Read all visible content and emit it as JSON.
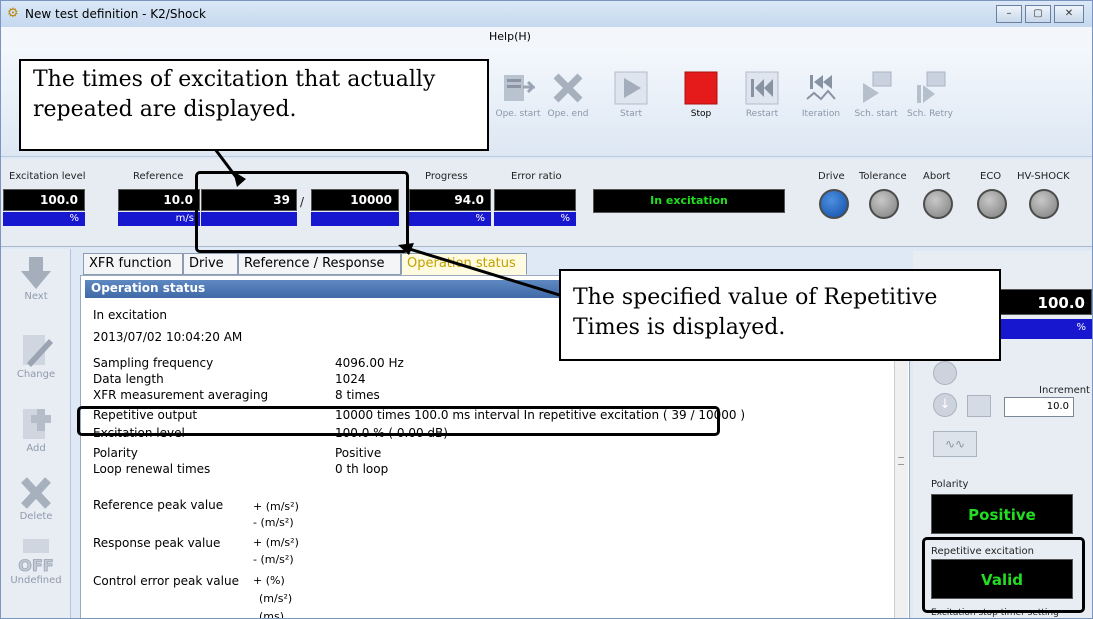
{
  "window": {
    "title": "New test definition - K2/Shock",
    "icon": "app-gear-icon",
    "min": "–",
    "max": "▢",
    "close": "✕"
  },
  "menu": {
    "help": "Help(H)"
  },
  "toolbar": {
    "buttons": [
      {
        "label": "Ope. start",
        "icon": "ope-start-icon"
      },
      {
        "label": "Ope. end",
        "icon": "ope-end-icon"
      },
      {
        "label": "Start",
        "icon": "play-icon"
      },
      {
        "label": "Stop",
        "icon": "stop-icon"
      },
      {
        "label": "Restart",
        "icon": "restart-icon"
      },
      {
        "label": "Iteration",
        "icon": "iteration-icon"
      },
      {
        "label": "Sch. start",
        "icon": "schedule-start-icon"
      },
      {
        "label": "Sch. Retry",
        "icon": "schedule-retry-icon"
      }
    ],
    "accent_stop": "#e51b1b"
  },
  "status": {
    "labels": {
      "excitation_level": "Excitation level",
      "reference": "Reference",
      "progress": "Progress",
      "error_ratio": "Error ratio",
      "drive": "Drive",
      "tolerance": "Tolerance",
      "abort": "Abort",
      "eco": "ECO",
      "hv_shock": "HV-SHOCK"
    },
    "values": {
      "excitation_level": "100.0",
      "reference": "10.0",
      "repeat_current": "39",
      "slash": "/",
      "repeat_total": "10000",
      "progress": "94.0",
      "error_ratio": ""
    },
    "units": {
      "excitation_level": "%",
      "reference": "m/s",
      "progress": "%",
      "error_ratio": "%"
    },
    "state": "In excitation",
    "drive_color": "#0f4fa8"
  },
  "sidebar": [
    {
      "label": "Next",
      "icon": "arrow-down-icon"
    },
    {
      "label": "Change",
      "icon": "pencil-icon"
    },
    {
      "label": "Add",
      "icon": "plus-icon"
    },
    {
      "label": "Delete",
      "icon": "x-icon"
    },
    {
      "label": "Undefined",
      "icon": "off-icon",
      "badge": "OFF"
    }
  ],
  "tabs": [
    "XFR function",
    "Drive",
    "Reference / Response",
    "Operation status"
  ],
  "panel": {
    "header": "Operation status",
    "state": "In excitation",
    "timestamp": "2013/07/02 10:04:20 AM",
    "rows": [
      {
        "k": "Sampling frequency",
        "v": "4096.00 Hz"
      },
      {
        "k": "Data length",
        "v": "1024"
      },
      {
        "k": "XFR measurement averaging",
        "v": "8 times"
      },
      {
        "k": "Repetitive output",
        "v": "10000 times 100.0 ms interval In repetitive excitation ( 39 / 10000 )"
      },
      {
        "k": "Excitation level",
        "v": "100.0 % ( 0.00 dB)"
      },
      {
        "k": "Polarity",
        "v": "Positive"
      },
      {
        "k": "Loop renewal times",
        "v": "0 th loop"
      }
    ],
    "peaks": [
      {
        "k": "Reference peak value",
        "u1": "+ (m/s²)",
        "u2": "- (m/s²)"
      },
      {
        "k": "Response peak value",
        "u1": "+ (m/s²)",
        "u2": "- (m/s²)"
      },
      {
        "k": "Control error peak value",
        "u1": "+ (%)",
        "u2": "(m/s²)",
        "u3": "(ms)"
      }
    ]
  },
  "right": {
    "level": "100.0",
    "unit": "%",
    "increment_label": "Increment",
    "increment_value": "10.0",
    "polarity_label": "Polarity",
    "polarity_value": "Positive",
    "rep_label": "Repetitive excitation",
    "rep_value": "Valid",
    "timer_label": "Excitation stop timer setting",
    "green": "#22dd22"
  },
  "callouts": {
    "c1": "The times of excitation that actually repeated are displayed.",
    "c2": "The specified value of Repetitive Times is displayed."
  }
}
